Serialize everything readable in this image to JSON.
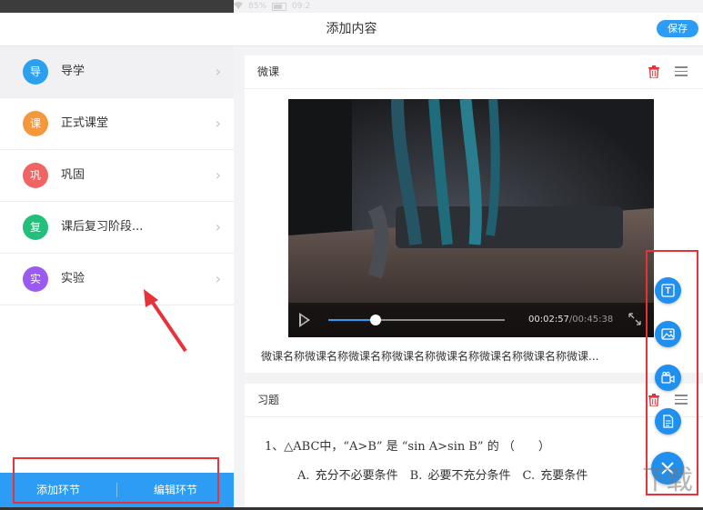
{
  "status_bar": {
    "battery": "85%",
    "time": "09:2"
  },
  "header": {
    "title": "添加内容",
    "save_label": "保存"
  },
  "sidebar": {
    "items": [
      {
        "badge": "导",
        "label": "导学",
        "color": "#2aa0ef",
        "active": true
      },
      {
        "badge": "课",
        "label": "正式课堂",
        "color": "#f5973b"
      },
      {
        "badge": "巩",
        "label": "巩固",
        "color": "#f06464"
      },
      {
        "badge": "复",
        "label": "课后复习阶段...",
        "color": "#22c07a"
      },
      {
        "badge": "实",
        "label": "实验",
        "color": "#9a5cf0"
      }
    ],
    "add_label": "添加环节",
    "edit_label": "编辑环节"
  },
  "video_card": {
    "title": "微课",
    "current_time": "00:02:57",
    "separator": "/",
    "total_time": "00:45:38",
    "progress": 0.27,
    "caption": "微课名称微课名称微课名称微课名称微课名称微课名称微课名称微课..."
  },
  "exercise_card": {
    "title": "习题",
    "question": "1、△ABC中，“A>B” 是 “sin A>sin B” 的 （　　）",
    "options": "A. 充分不必要条件　B. 必要不充分条件　C. 充要条件"
  },
  "fab": {
    "icons": [
      "text-icon",
      "image-icon",
      "video-icon",
      "document-icon"
    ],
    "close_icon": "close-icon"
  },
  "colors": {
    "accent": "#2d9cf5",
    "highlight": "#e8323a"
  }
}
